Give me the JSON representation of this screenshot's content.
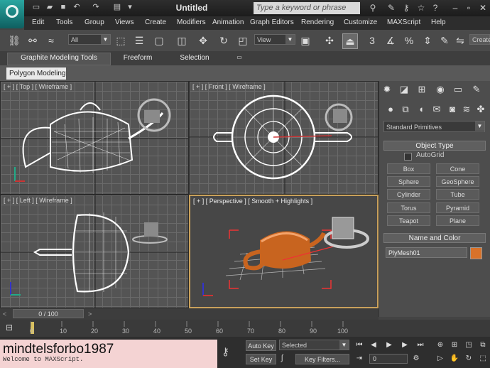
{
  "app": {
    "title": "Untitled",
    "search_placeholder": "Type a keyword or phrase"
  },
  "menu": [
    "Edit",
    "Tools",
    "Group",
    "Views",
    "Create",
    "Modifiers",
    "Animation",
    "Graph Editors",
    "Rendering",
    "Customize",
    "MAXScript",
    "Help"
  ],
  "toolbar": {
    "selection_filter": "All",
    "ref_coord": "View",
    "create_label": "Create"
  },
  "ribbon": {
    "tabs": [
      "Graphite Modeling Tools",
      "Freeform",
      "Selection"
    ],
    "sub": "Polygon Modeling"
  },
  "viewports": {
    "top": "[ + ] [ Top ] [ Wireframe ]",
    "front": "[ + ] [ Front ] [ Wireframe ]",
    "left": "[ + ] [ Left ] [ Wireframe ]",
    "persp": "[ + ] [ Perspective ] [ Smooth + Highlights ]"
  },
  "command_panel": {
    "category": "Standard Primitives",
    "object_type_title": "Object Type",
    "autogrid": "AutoGrid",
    "buttons": [
      "Box",
      "Cone",
      "Sphere",
      "GeoSphere",
      "Cylinder",
      "Tube",
      "Torus",
      "Pyramid",
      "Teapot",
      "Plane"
    ],
    "name_color_title": "Name and Color",
    "object_name": "PlyMesh01",
    "object_color": "#d8722a"
  },
  "timeline": {
    "frame_display": "0 / 100",
    "ticks": [
      "0",
      "10",
      "20",
      "30",
      "40",
      "50",
      "60",
      "70",
      "80",
      "90",
      "100"
    ]
  },
  "bottom": {
    "script_text": "mindtelsforbo1987",
    "script_sub": "Welcome to MAXScript.",
    "auto_key": "Auto Key",
    "set_key": "Set Key",
    "selected": "Selected",
    "key_filters": "Key Filters...",
    "frame": "0"
  }
}
